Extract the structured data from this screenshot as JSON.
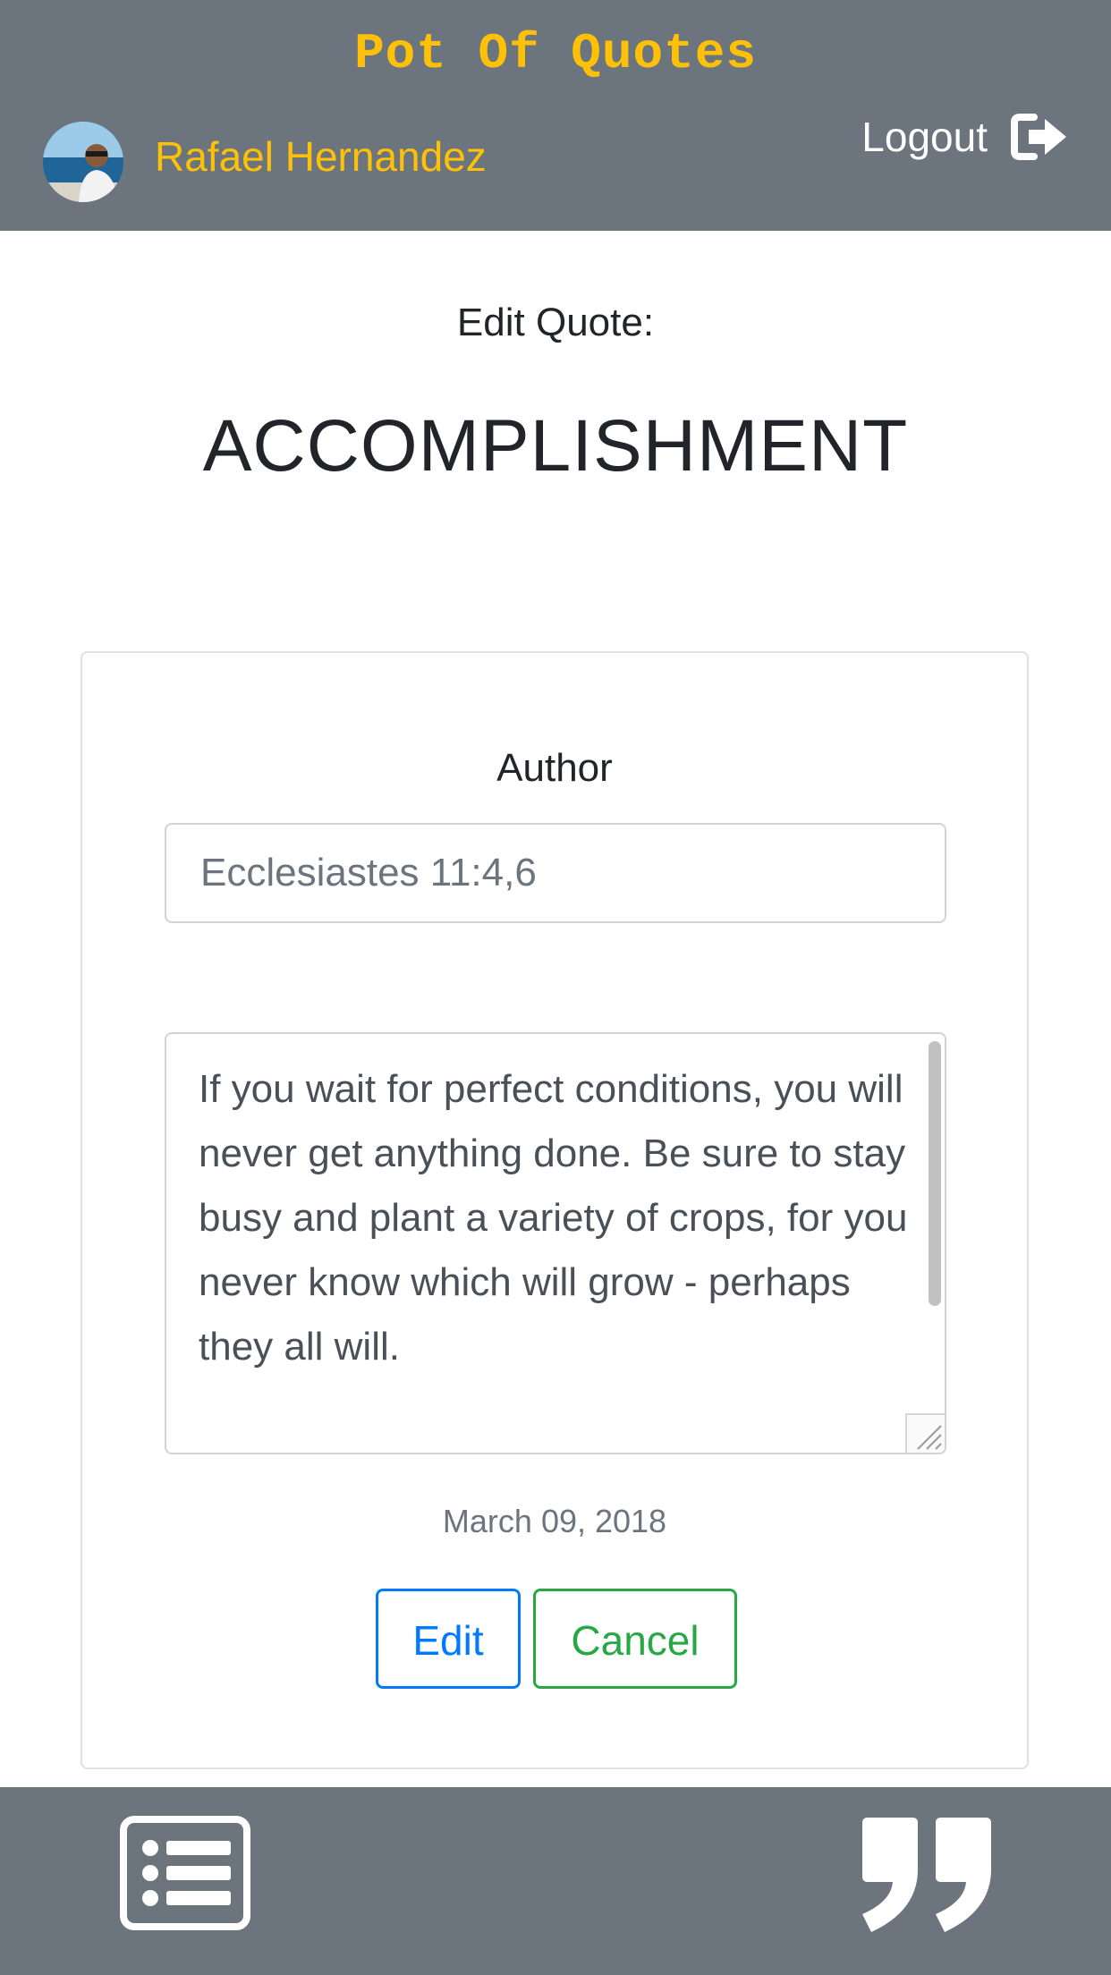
{
  "header": {
    "app_title": "Pot Of Quotes",
    "user_name": "Rafael Hernandez",
    "logout_label": "Logout",
    "logout_icon": "sign-out-icon",
    "avatar_icon": "user-avatar"
  },
  "page": {
    "subtitle": "Edit Quote:",
    "category": "ACCOMPLISHMENT"
  },
  "form": {
    "author_label": "Author",
    "author_value": "Ecclesiastes 11:4,6",
    "quote_text": "If you wait for perfect conditions, you will never get anything done. Be sure to stay busy and plant a variety of crops, for you never know which will grow - perhaps they all will.",
    "date": "March 09, 2018",
    "edit_label": "Edit",
    "cancel_label": "Cancel"
  },
  "footer": {
    "list_icon": "list-icon",
    "quote_icon": "quote-right-icon"
  },
  "colors": {
    "header_bg": "#6c757d",
    "accent": "#ffc107",
    "edit": "#007bff",
    "cancel": "#28a745"
  }
}
